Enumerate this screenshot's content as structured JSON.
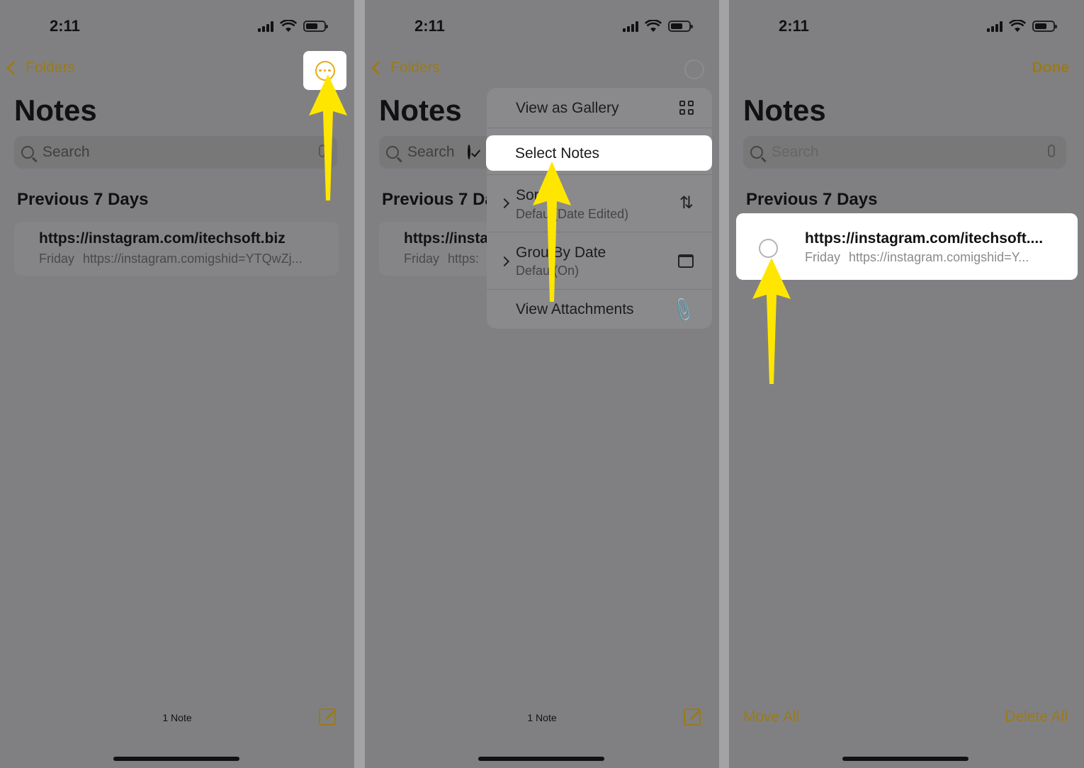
{
  "status": {
    "time": "2:11"
  },
  "nav": {
    "back_label": "Folders",
    "done_label": "Done"
  },
  "page_title": "Notes",
  "search": {
    "placeholder": "Search"
  },
  "section_header": "Previous 7 Days",
  "note": {
    "title": "https://instagram.com/itechsoft.biz",
    "title_truncated": "https://instagram.com/itechsoft....",
    "title_cut": "https://insta",
    "date": "Friday",
    "preview": "https://instagram.comigshid=YTQwZj...",
    "preview_truncated": "https://instagram.comigshid=Y...",
    "preview_cut": "https:"
  },
  "section_header_cut": "Previous 7 Da",
  "footer": {
    "count": "1 Note",
    "move_all": "Move All",
    "delete_all": "Delete All"
  },
  "menu": {
    "view_gallery": "View as Gallery",
    "select_notes": "Select Notes",
    "sort_label": "Sor",
    "sort_sub": "Defau   (Date Edited)",
    "group_label": "Grou    By Date",
    "group_sub": "Defau   (On)",
    "view_attachments": "View Attachments"
  },
  "icons": {
    "more": "ellipsis-circle-icon",
    "search": "magnifier-icon",
    "mic": "microphone-icon",
    "compose": "compose-icon",
    "gallery": "grid-icon",
    "select": "checkmark-circle-icon",
    "sort": "sort-arrows-icon",
    "group": "calendar-icon",
    "attachments": "paperclip-icon"
  },
  "colors": {
    "accent": "#e3ad19",
    "arrow": "#ffe600",
    "dim_accent": "#9a7a18"
  }
}
